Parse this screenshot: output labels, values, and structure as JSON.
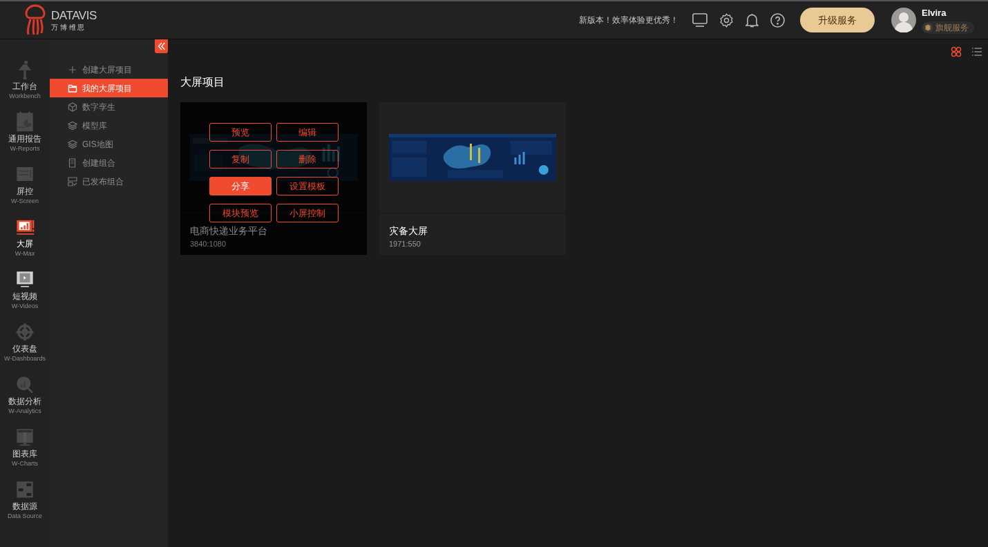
{
  "header": {
    "logo": {
      "name": "DATAVIS",
      "subtitle": "万 博 维 思"
    },
    "notice": "新版本！效率体验更优秀！",
    "upgrade_button": "升级服务",
    "user": {
      "name": "Elvira",
      "plan": "旗舰服务"
    }
  },
  "rail": [
    {
      "label": "工作台",
      "sub": "Workbench",
      "selected": false
    },
    {
      "label": "通用报告",
      "sub": "W-Reports",
      "selected": false
    },
    {
      "label": "屏控",
      "sub": "W-Screen",
      "selected": false
    },
    {
      "label": "大屏",
      "sub": "W-Max",
      "selected": true
    },
    {
      "label": "短视频",
      "sub": "W-Videos",
      "selected": false
    },
    {
      "label": "仪表盘",
      "sub": "W-Dashboards",
      "selected": false
    },
    {
      "label": "数据分析",
      "sub": "W-Analytics",
      "selected": false
    },
    {
      "label": "图表库",
      "sub": "W-Charts",
      "selected": false
    },
    {
      "label": "数据源",
      "sub": "Data Source",
      "selected": false
    }
  ],
  "menu": [
    {
      "label": "创建大屏项目",
      "selected": false
    },
    {
      "label": "我的大屏项目",
      "selected": true
    },
    {
      "label": "数字孪生",
      "selected": false
    },
    {
      "label": "模型库",
      "selected": false
    },
    {
      "label": "GIS地图",
      "selected": false
    },
    {
      "label": "创建组合",
      "selected": false
    },
    {
      "label": "已发布组合",
      "selected": false
    }
  ],
  "view_toggle": [
    {
      "kind": "grid",
      "selected": true
    },
    {
      "kind": "list",
      "selected": false
    }
  ],
  "section_title": "大屏项目",
  "projects": [
    {
      "title": "电商快递业务平台",
      "ratio": "3840:1080",
      "hovered": true,
      "actions": [
        {
          "label": "预览",
          "selected": false
        },
        {
          "label": "编辑",
          "selected": false
        },
        {
          "label": "复制",
          "selected": false
        },
        {
          "label": "删除",
          "selected": false
        },
        {
          "label": "分享",
          "selected": true
        },
        {
          "label": "设置模板",
          "selected": false
        },
        {
          "label": "模块预览",
          "selected": false
        },
        {
          "label": "小屏控制",
          "selected": false
        }
      ]
    },
    {
      "title": "灾备大屏",
      "ratio": "1971:550",
      "hovered": false
    }
  ]
}
